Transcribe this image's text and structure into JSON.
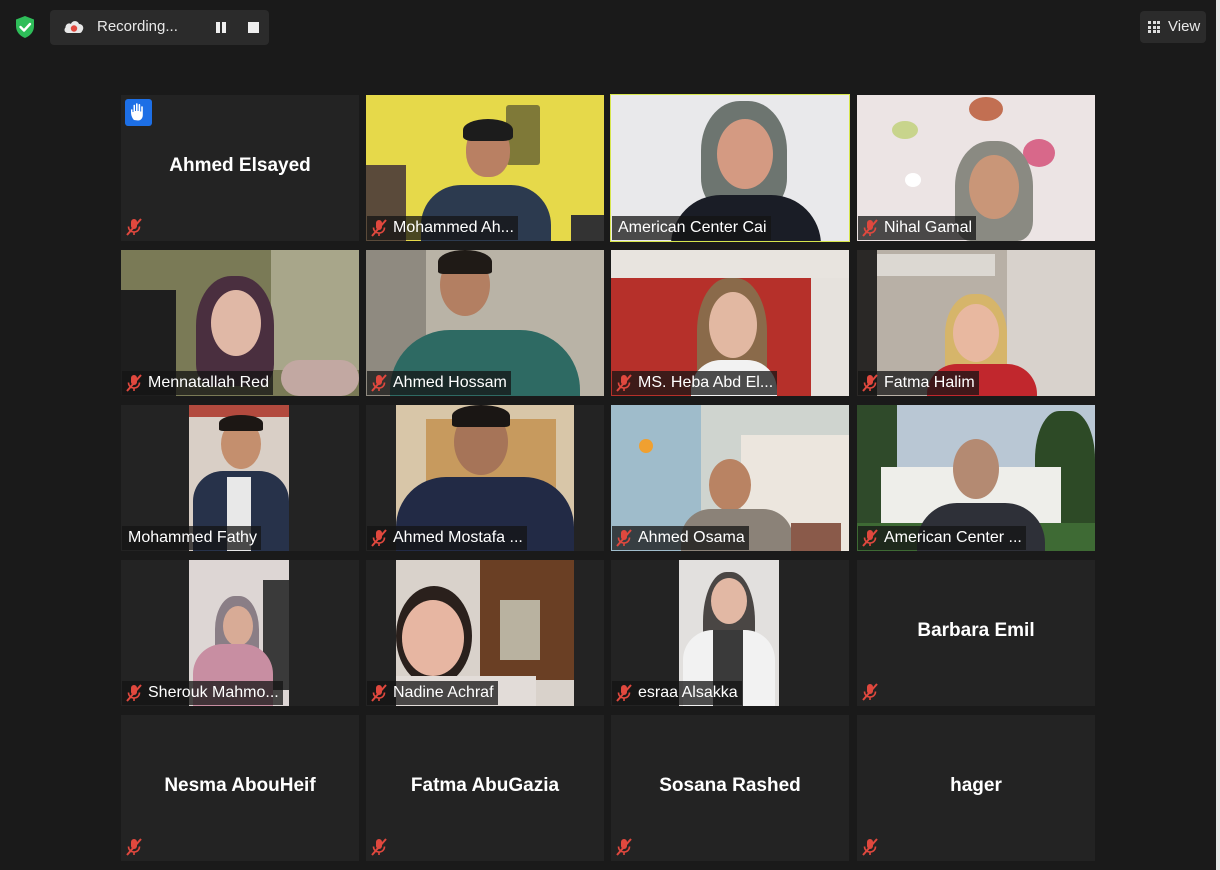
{
  "topbar": {
    "recording_label": "Recording...",
    "view_label": "View"
  },
  "participants": [
    {
      "name": "Ahmed Elsayed",
      "video": false,
      "raised_hand": true
    },
    {
      "name": "Mohammed Ah...",
      "video": true
    },
    {
      "name": "American Center Cai",
      "video": true,
      "active_speaker": true
    },
    {
      "name": "Nihal Gamal",
      "video": true
    },
    {
      "name": "Mennatallah Red",
      "video": true
    },
    {
      "name": "Ahmed Hossam",
      "video": true
    },
    {
      "name": "MS. Heba Abd El...",
      "video": true
    },
    {
      "name": "Fatma Halim",
      "video": true
    },
    {
      "name": "Mohammed Fathy",
      "video": true
    },
    {
      "name": "Ahmed Mostafa ...",
      "video": true
    },
    {
      "name": "Ahmed Osama",
      "video": true
    },
    {
      "name": "American Center ...",
      "video": true
    },
    {
      "name": "Sherouk Mahmo...",
      "video": true
    },
    {
      "name": "Nadine Achraf",
      "video": true
    },
    {
      "name": "esraa Alsakka",
      "video": true
    },
    {
      "name": "Barbara Emil",
      "video": false
    },
    {
      "name": "Nesma AbouHeif",
      "video": false
    },
    {
      "name": "Fatma AbuGazia",
      "video": false
    },
    {
      "name": "Sosana Rashed",
      "video": false
    },
    {
      "name": "hager",
      "video": false
    }
  ],
  "colors": {
    "background": "#1a1a1a",
    "tile": "#232323",
    "active_speaker_border": "#d7e64c",
    "mute_icon": "#e0483e",
    "raised_hand": "#1d6fe6",
    "shield": "#2ebd59"
  }
}
